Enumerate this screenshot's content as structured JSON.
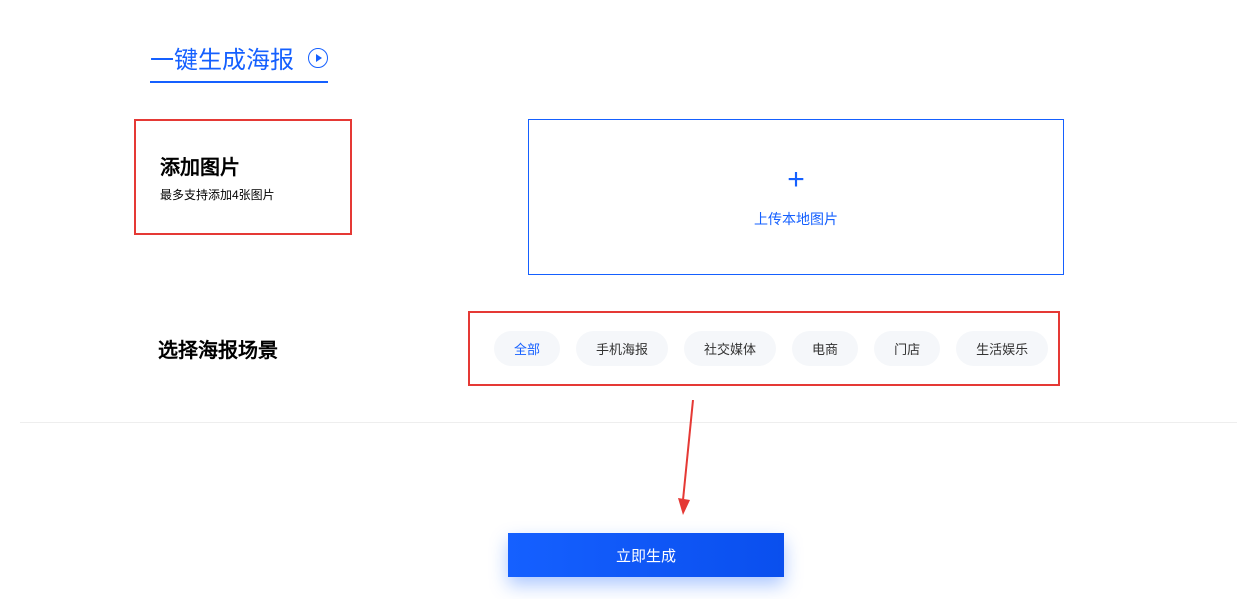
{
  "header": {
    "title": "一键生成海报"
  },
  "addImage": {
    "title": "添加图片",
    "subtitle": "最多支持添加4张图片"
  },
  "upload": {
    "label": "上传本地图片"
  },
  "scene": {
    "label": "选择海报场景",
    "tabs": [
      "全部",
      "手机海报",
      "社交媒体",
      "电商",
      "门店",
      "生活娱乐"
    ]
  },
  "generate": {
    "label": "立即生成"
  }
}
